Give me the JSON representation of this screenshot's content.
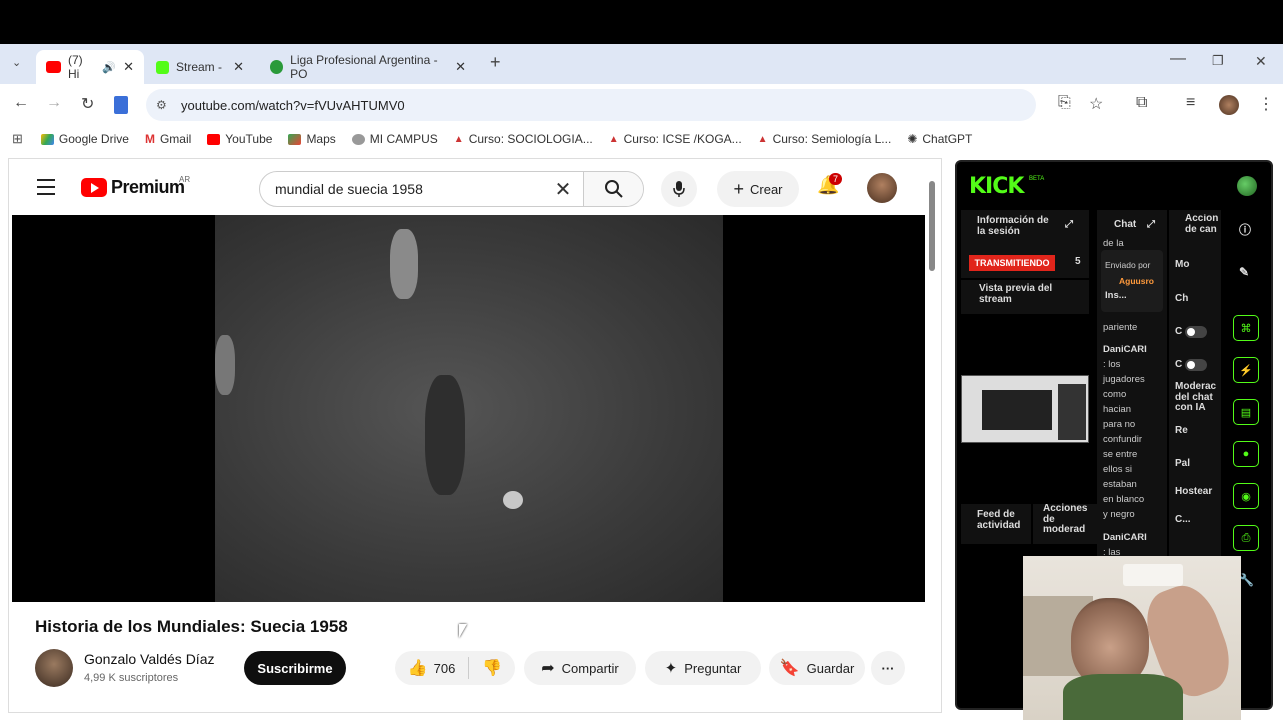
{
  "browser": {
    "tabs": [
      {
        "label": "(7) Hi",
        "active": true,
        "audio": true
      },
      {
        "label": "Stream -",
        "active": false
      },
      {
        "label": "Liga Profesional Argentina - PO",
        "active": false
      }
    ],
    "new_tab": "+",
    "url": "youtube.com/watch?v=fVUvAHTUMV0",
    "bookmarks": [
      "Google Drive",
      "Gmail",
      "YouTube",
      "Maps",
      "MI CAMPUS",
      "Curso: SOCIOLOGIA...",
      "Curso: ICSE /KOGA...",
      "Curso: Semiología L...",
      "ChatGPT"
    ]
  },
  "youtube": {
    "brand": "Premium",
    "country": "AR",
    "search_query": "mundial de suecia 1958",
    "create_label": "Crear",
    "notifications": "7",
    "video_title": "Historia de los Mundiales: Suecia 1958",
    "channel_name": "Gonzalo Valdés Díaz",
    "subscribers": "4,99 K suscriptores",
    "subscribe_label": "Suscribirme",
    "likes": "706",
    "share_label": "Compartir",
    "ask_label": "Preguntar",
    "save_label": "Guardar"
  },
  "kick": {
    "logo": "KICK",
    "beta": "BETA",
    "session_info": "Información de la sesión",
    "live_badge": "TRANSMITIENDO",
    "viewers": "5",
    "stream_preview": "Vista previa del stream",
    "activity_feed": "Feed de actividad",
    "mod_actions": "Acciones de moderad",
    "chat_title": "Chat",
    "channel_actions": "Accion de can",
    "pinned_by": "Enviado por",
    "pinned_user": "Aguusro",
    "pinned_text": "Ins...",
    "chat_fragment_top": "de la",
    "chat_lines": [
      "pariente"
    ],
    "chat_user_1": "DaniCARI",
    "chat_message_1": [
      ": los",
      "jugadores",
      "como",
      "hacian",
      "para no",
      "confundir",
      "se entre",
      "ellos si",
      "estaban",
      "en blanco",
      "y negro"
    ],
    "chat_user_2": "DaniCARI",
    "chat_message_2": [
      ": las"
    ],
    "actions": [
      "Mo",
      "Ch",
      "C",
      "C",
      "Moderac del chat con IA",
      "Re",
      "Pal",
      "Hostear",
      "C..."
    ]
  },
  "colors": {
    "kick_green": "#53fc18",
    "youtube_red": "#ff0000",
    "live_red": "#e1251b"
  }
}
